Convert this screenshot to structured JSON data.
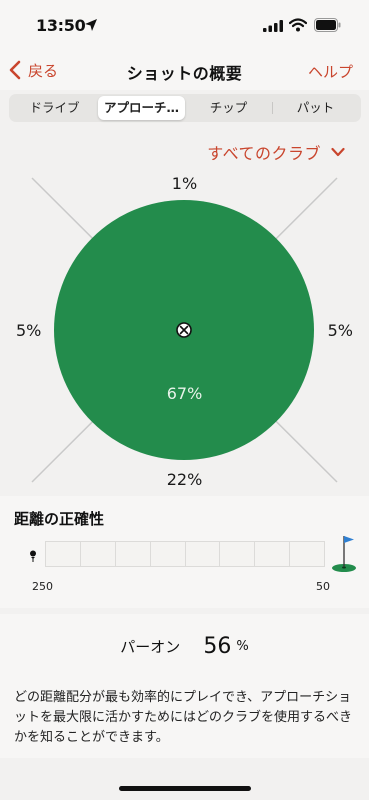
{
  "status_bar": {
    "time": "13:50"
  },
  "nav": {
    "back_label": "戻る",
    "title": "ショットの概要",
    "help_label": "ヘルプ"
  },
  "tabs": [
    {
      "label": "ドライブ",
      "selected": false
    },
    {
      "label": "アプローチ…",
      "selected": true
    },
    {
      "label": "チップ",
      "selected": false
    },
    {
      "label": "パット",
      "selected": false
    }
  ],
  "club_filter": {
    "label": "すべてのクラブ"
  },
  "dispersion": {
    "long": "1%",
    "short": "22%",
    "left": "5%",
    "right": "5%",
    "on_target": "67%",
    "colors": {
      "green": "#238c4c",
      "accent": "#c9452d"
    }
  },
  "distance_accuracy": {
    "title": "距離の正確性",
    "start_value": "250",
    "end_value": "50"
  },
  "green_in_regulation": {
    "label": "パーオン",
    "value": "56",
    "unit": "%",
    "description": "どの距離配分が最も効率的にプレイでき、アプローチショットを最大限に活かすためにはどのクラブを使用するべきかを知ることができます。"
  }
}
